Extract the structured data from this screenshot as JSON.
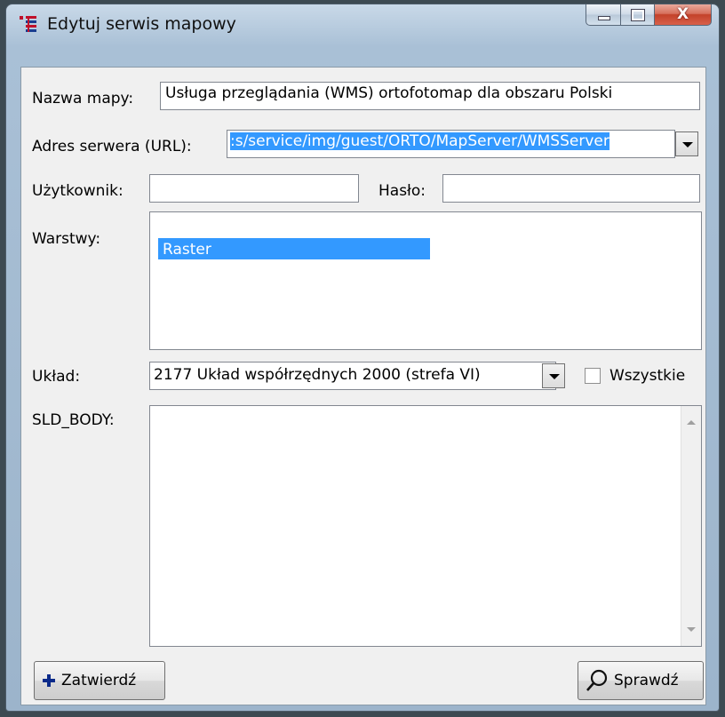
{
  "window": {
    "title": "Edytuj serwis mapowy",
    "close_glyph": "X"
  },
  "form": {
    "map_name_label": "Nazwa mapy:",
    "map_name_value": "Usługa przeglądania (WMS) ortofotomap dla obszaru Polski",
    "server_url_label": "Adres serwera (URL):",
    "server_url_value": ":s/service/img/guest/ORTO/MapServer/WMSServer",
    "user_label": "Użytkownik:",
    "user_value": "",
    "password_label": "Hasło:",
    "password_value": "",
    "layers_label": "Warstwy:",
    "layers": [
      "Raster"
    ],
    "crs_label": "Układ:",
    "crs_value": "2177 Układ współrzędnych 2000 (strefa VI)",
    "all_label": "Wszystkie",
    "all_checked": false,
    "sld_label": "SLD_BODY:",
    "sld_value": ""
  },
  "buttons": {
    "confirm_label": "Zatwierdź",
    "check_label": "Sprawdź"
  },
  "colors": {
    "selection": "#3399ff",
    "confirm_icon": "#0b2a8a",
    "app_icon_red": "#c0102a"
  },
  "icons": {
    "app": "app-layers-icon",
    "confirm": "plus-icon",
    "check": "magnifier-icon"
  }
}
